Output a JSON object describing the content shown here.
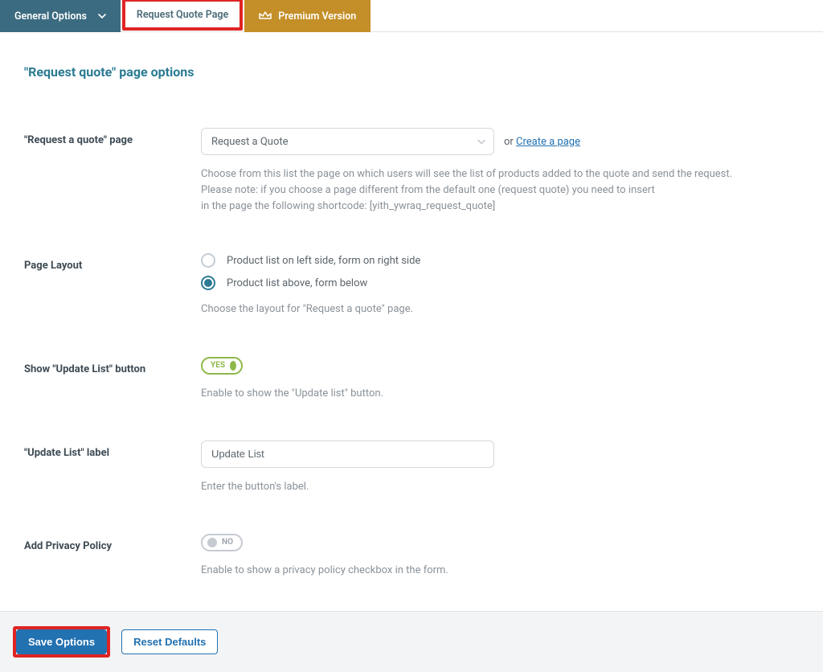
{
  "tabs": {
    "general": "General Options",
    "request": "Request Quote Page",
    "premium": "Premium Version"
  },
  "page": {
    "title": "\"Request quote\" page options"
  },
  "fields": {
    "quote_page": {
      "label": "\"Request a quote\" page",
      "value": "Request a Quote",
      "or_text": "or ",
      "create_link": "Create a page",
      "desc1": "Choose from this list the page on which users will see the list of products added to the quote and send the request.",
      "desc2": "Please note: if you choose a page different from the default one (request quote) you need to insert",
      "desc3": "in the page the following shortcode: [yith_ywraq_request_quote]"
    },
    "layout": {
      "label": "Page Layout",
      "opt1": "Product list on left side, form on right side",
      "opt2": "Product list above, form below",
      "selected": "opt2",
      "desc": "Choose the layout for \"Request a quote\" page."
    },
    "show_update": {
      "label": "Show \"Update List\" button",
      "state": "YES",
      "desc": "Enable to show the \"Update list\" button."
    },
    "update_label": {
      "label": "\"Update List\" label",
      "value": "Update List",
      "desc": "Enter the button's label."
    },
    "privacy": {
      "label": "Add Privacy Policy",
      "state": "NO",
      "desc": "Enable to show a privacy policy checkbox in the form."
    }
  },
  "footer": {
    "save": "Save Options",
    "reset": "Reset Defaults"
  }
}
